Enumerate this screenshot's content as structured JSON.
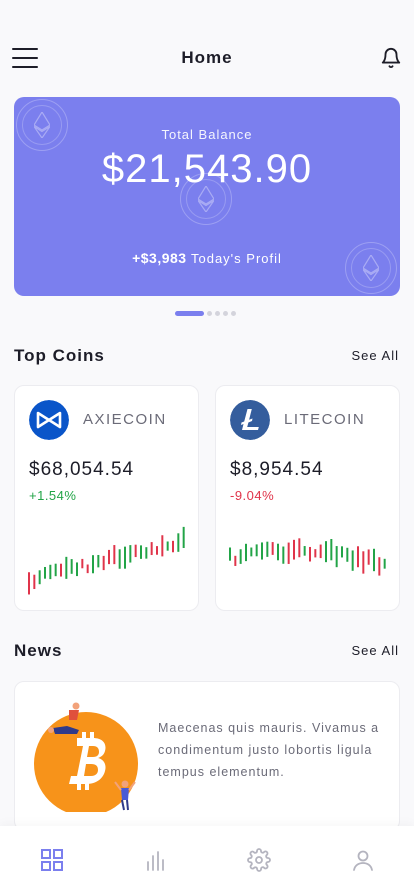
{
  "header": {
    "title": "Home"
  },
  "balance": {
    "label": "Total Balance",
    "amount": "$21,543.90",
    "profit_value": "+$3,983",
    "profit_label": "Today's Profil"
  },
  "pager": {
    "pages": 5,
    "active": 0
  },
  "top_coins": {
    "title": "Top Coins",
    "see_all": "See All",
    "coins": [
      {
        "name": "AXIECOIN",
        "price": "$68,054.54",
        "change": "+1.54%",
        "trend": "up",
        "logo_color": "#0a55c9"
      },
      {
        "name": "LITECOIN",
        "price": "$8,954.54",
        "change": "-9.04%",
        "trend": "down",
        "logo_color": "#345d9d"
      }
    ]
  },
  "news": {
    "title": "News",
    "see_all": "See All",
    "item": {
      "text": "Maecenas quis mauris. Vivamus a condimentum justo lobortis ligula tempus elementum.",
      "image": "bitcoin-illustration"
    }
  },
  "tabbar": {
    "items": [
      "home-grid-icon",
      "chart-bars-icon",
      "settings-gear-icon",
      "profile-user-icon"
    ],
    "active": 0
  },
  "colors": {
    "accent": "#7b7fee",
    "positive": "#22a447",
    "negative": "#e0344a",
    "bitcoin": "#f7931a"
  }
}
